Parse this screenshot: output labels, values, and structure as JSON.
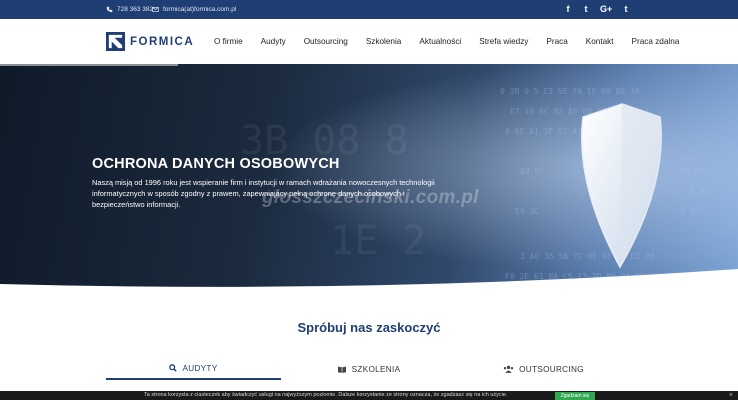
{
  "topbar": {
    "phone": "728 363 382",
    "email": "formica(at)formica.com.pl",
    "social": [
      {
        "icon": "facebook-icon",
        "glyph": "f"
      },
      {
        "icon": "twitter-icon",
        "glyph": "t"
      },
      {
        "icon": "google-plus-icon",
        "glyph": "G+"
      },
      {
        "icon": "tumblr-icon",
        "glyph": "t"
      }
    ]
  },
  "header": {
    "logo_text": "FORMICA",
    "nav": [
      "O firmie",
      "Audyty",
      "Outsourcing",
      "Szkolenia",
      "Aktualności",
      "Strefa wiedzy",
      "Praca",
      "Kontakt",
      "Praca zdalna"
    ]
  },
  "hero": {
    "title": "OCHRONA DANYCH OSOBOWYCH",
    "description": "Naszą misją od 1996 roku jest wspieranie firm i instytucji w ramach wdrażania nowoczesnych technologii informatycznych w sposób zgodny z prawem, zapewniający pełną ochronę danych osobowych i bezpieczeństwo informacji.",
    "watermark": "głosszczecinski.com.pl"
  },
  "section": {
    "title": "Spróbuj nas zaskoczyć"
  },
  "tabs": {
    "audits": "AUDYTY",
    "training": "SZKOLENIA",
    "outsourcing": "OUTSOURCING"
  },
  "cookie": {
    "text": "Ta strona korzysta z ciasteczek aby świadczyć usługi na najwyższym poziomie. Dalsze korzystanie ze strony oznacza, że zgadzasz się na ich użycie.",
    "button": "Zgadzam się",
    "close": "×"
  },
  "colors": {
    "brand": "#1f3f74",
    "accept": "#2fa84f"
  }
}
